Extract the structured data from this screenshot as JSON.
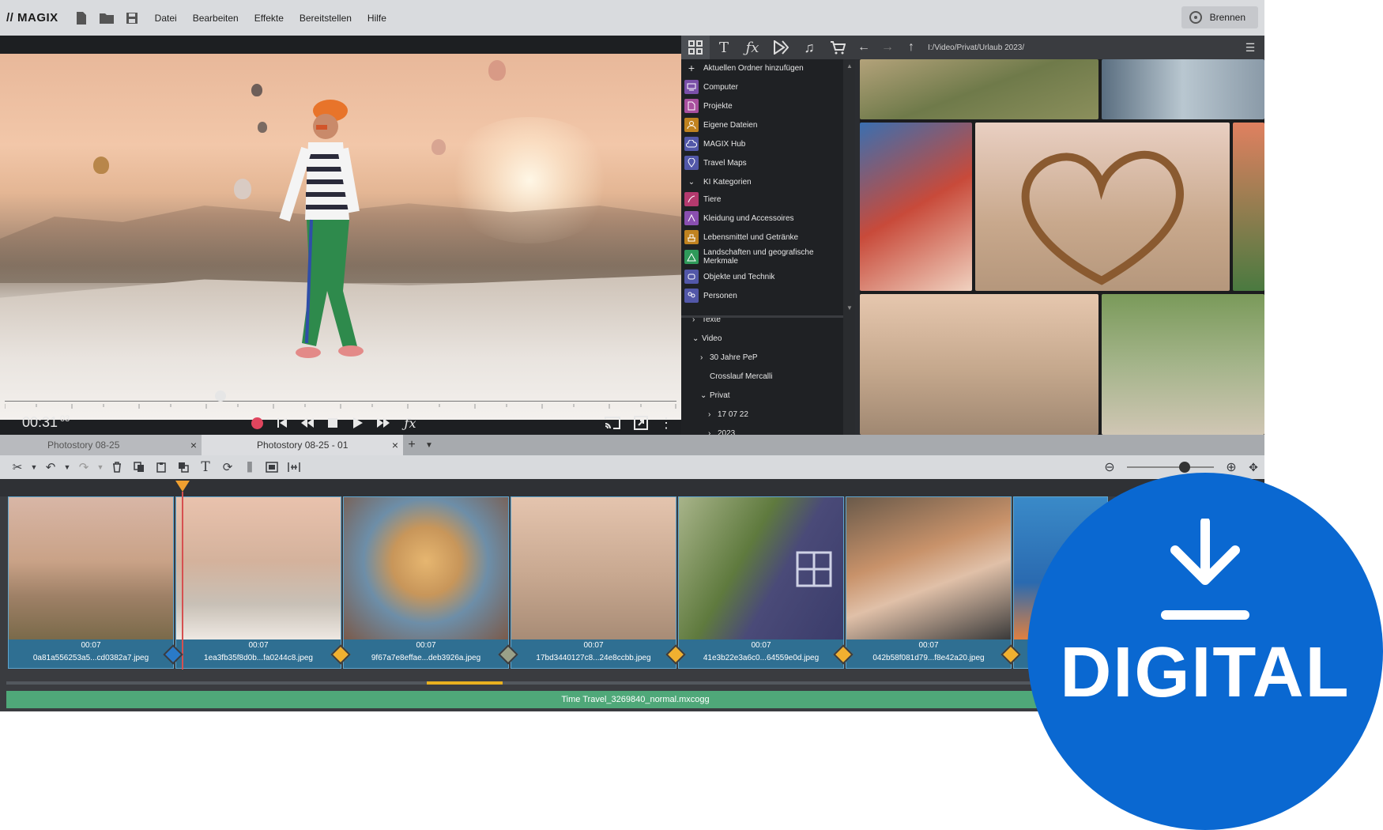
{
  "app": {
    "logo": "// MAGIX",
    "menu": [
      "Datei",
      "Bearbeiten",
      "Effekte",
      "Bereitstellen",
      "Hilfe"
    ],
    "burn_label": "Brennen"
  },
  "preview": {
    "timecode": "00:31",
    "timecode_frames": "03"
  },
  "media_panel": {
    "path": "I:/Video/Privat/Urlaub 2023/",
    "tree_top": [
      {
        "label": "Aktuellen Ordner hinzufügen",
        "icon": "plus-icon"
      },
      {
        "label": "Computer",
        "icon": "computer-icon"
      },
      {
        "label": "Projekte",
        "icon": "document-icon"
      },
      {
        "label": "Eigene Dateien",
        "icon": "user-icon"
      },
      {
        "label": "MAGIX Hub",
        "icon": "cloud-icon"
      },
      {
        "label": "Travel Maps",
        "icon": "map-pin-icon"
      },
      {
        "label": "KI Kategorien",
        "icon": "chevron-down-icon"
      },
      {
        "label": "Tiere",
        "icon": "animal-icon"
      },
      {
        "label": "Kleidung und Accessoires",
        "icon": "clothing-icon"
      },
      {
        "label": "Lebensmittel und Getränke",
        "icon": "food-icon"
      },
      {
        "label": "Landschaften und geografische Merkmale",
        "icon": "landscape-icon"
      },
      {
        "label": "Objekte und Technik",
        "icon": "object-icon"
      },
      {
        "label": "Personen",
        "icon": "people-icon"
      }
    ],
    "tree_bottom": [
      {
        "label": "Texte",
        "chev": "›",
        "indent": 0
      },
      {
        "label": "Video",
        "chev": "⌄",
        "indent": 0
      },
      {
        "label": "30 Jahre PeP",
        "chev": "›",
        "indent": 1
      },
      {
        "label": "Crosslauf Mercalli",
        "chev": "",
        "indent": 1
      },
      {
        "label": "Privat",
        "chev": "⌄",
        "indent": 1
      },
      {
        "label": "17 07 22",
        "chev": "›",
        "indent": 2
      },
      {
        "label": "2023",
        "chev": "›",
        "indent": 2
      }
    ]
  },
  "tabs": [
    {
      "label": "Photostory 08-25"
    },
    {
      "label": "Photostory 08-25 - 01"
    }
  ],
  "timeline": {
    "clips": [
      {
        "duration": "00:07",
        "name": "0a81a556253a5...cd0382a7.jpeg"
      },
      {
        "duration": "00:07",
        "name": "1ea3fb35f8d0b...fa0244c8.jpeg"
      },
      {
        "duration": "00:07",
        "name": "9f67a7e8effae...deb3926a.jpeg"
      },
      {
        "duration": "00:07",
        "name": "17bd3440127c8...24e8ccbb.jpeg"
      },
      {
        "duration": "00:07",
        "name": "41e3b22e3a6c0...64559e0d.jpeg"
      },
      {
        "duration": "00:07",
        "name": "042b58f081d79...f8e42a20.jpeg"
      },
      {
        "duration": "",
        "name": ""
      }
    ],
    "audio_track": "Time Travel_3269840_normal.mxcogg"
  },
  "badge": {
    "text": "DIGITAL",
    "color": "#0a68d1"
  },
  "colors": {
    "accent_record": "#e0455e",
    "playhead": "#f0a030",
    "clip_blue": "#2f6f92",
    "audio_green": "#4fa879"
  }
}
